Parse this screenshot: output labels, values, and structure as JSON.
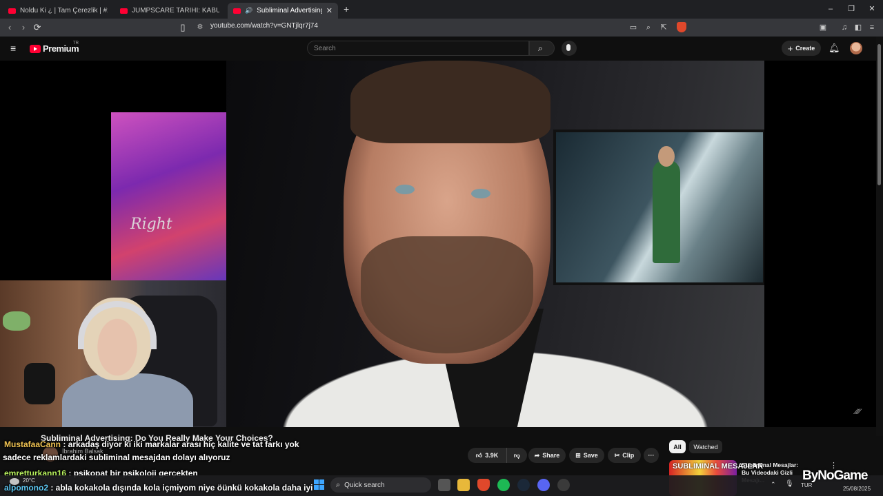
{
  "browser": {
    "tabs": [
      {
        "title": "Noldu Ki ¿ | Tam Çerezlik | #244 - Yo"
      },
      {
        "title": "JUMPSCARE TARİHİ: KABUS NASIL E"
      },
      {
        "title": "Subliminal Advertising: Do Yo"
      }
    ],
    "new_tab": "+",
    "window_controls": {
      "minimize": "–",
      "restore": "❐",
      "close": "✕"
    },
    "url": "youtube.com/watch?v=GNTjlqr7j74"
  },
  "youtube": {
    "logo_text": "Premium",
    "logo_region": "TR",
    "search_placeholder": "Search",
    "create_label": "Create",
    "video_watermark": "⁄⁄⁄⁄",
    "video_title": "Subliminal Advertising: Do You Really Make Your Choices?",
    "channel": "İbrahim Balsak",
    "actions": {
      "likes": "3.9K",
      "share": "Share",
      "save": "Save",
      "clip": "Clip",
      "more": "···"
    },
    "chips": {
      "all": "All",
      "watched": "Watched"
    },
    "recommendation": {
      "thumb_text": "SUBLIMINAL MESAJLAR",
      "title": "Subliminal Mesajlar: Bu Videodaki Gizli Mesajı..."
    }
  },
  "overlay": {
    "brand": "ByNoGame",
    "chat": [
      {
        "user": "MustafaaCann",
        "message": " : arkadaş diyor ki iki markalar arası hiç kalite ve tat farkı yok"
      },
      {
        "user": "",
        "message": "sadece reklamlardaki subliminal mesajdan dolayı alıyoruz"
      },
      {
        "user": "emretturkann16",
        "message": " : psikopat bir psikoloji gerçekten"
      },
      {
        "user": "alpomono2",
        "message": " : abla kokakola dışında kola içmiyom niye öünkü kokakola daha iyi"
      }
    ]
  },
  "taskbar": {
    "weather": "20°C",
    "search_label": "Quick search",
    "language": "TUR",
    "date": "25/08/2025"
  },
  "colors": {
    "youtube_red": "#ff0033",
    "background": "#0f0f0f",
    "chat_user_1": "#f1c453",
    "chat_user_2": "#b9f35e",
    "chat_user_3": "#5ec8f3"
  }
}
